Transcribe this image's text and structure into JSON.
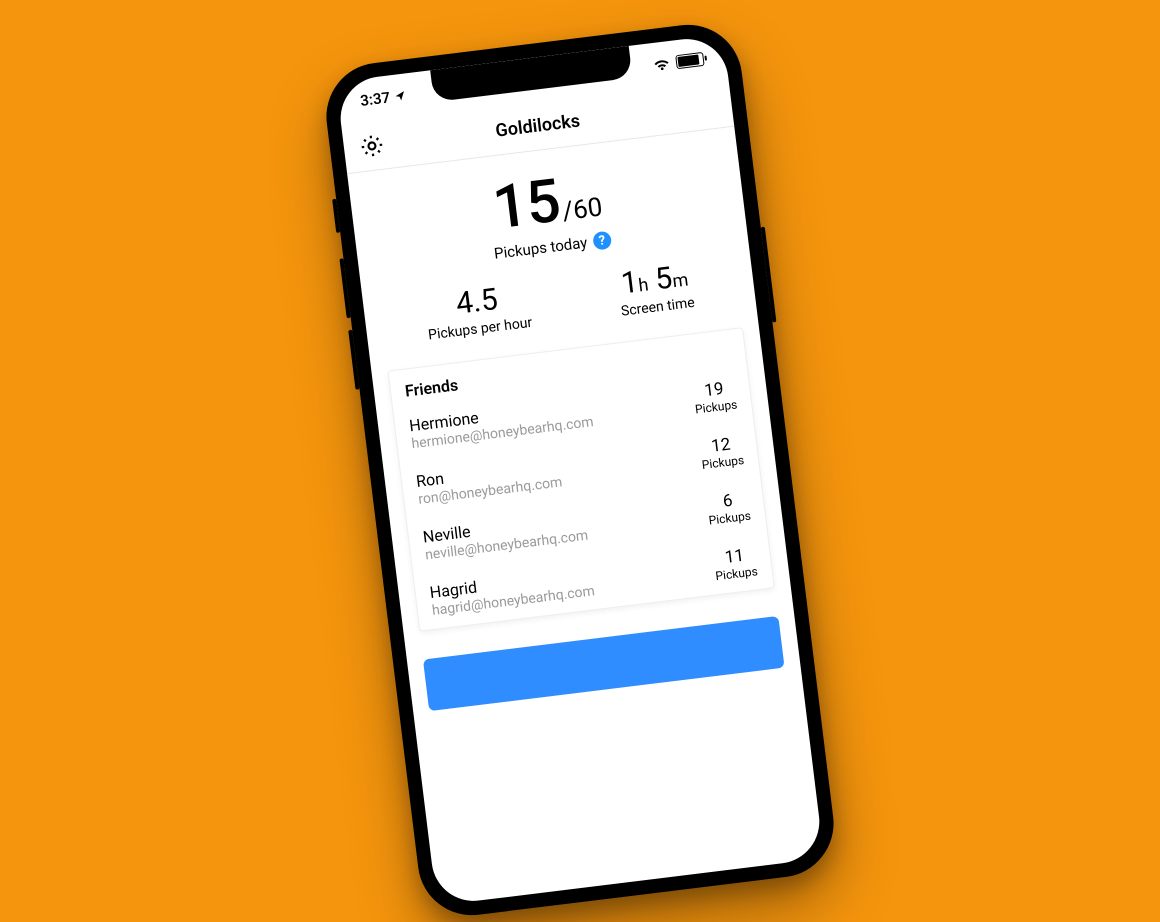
{
  "statusbar": {
    "time": "3:37"
  },
  "header": {
    "title": "Goldilocks"
  },
  "hero": {
    "pickups_current": "15",
    "pickups_cap": "60",
    "label": "Pickups today"
  },
  "stats": {
    "pickups_per_hour": {
      "value": "4.5",
      "label": "Pickups per hour"
    },
    "screen_time": {
      "hours": "1",
      "minutes": "5",
      "label": "Screen time"
    }
  },
  "friends": {
    "header": "Friends",
    "count_label": "Pickups",
    "items": [
      {
        "name": "Hermione",
        "email": "hermione@honeybearhq.com",
        "count": "19"
      },
      {
        "name": "Ron",
        "email": "ron@honeybearhq.com",
        "count": "12"
      },
      {
        "name": "Neville",
        "email": "neville@honeybearhq.com",
        "count": "6"
      },
      {
        "name": "Hagrid",
        "email": "hagrid@honeybearhq.com",
        "count": "11"
      }
    ]
  },
  "help_glyph": "?"
}
